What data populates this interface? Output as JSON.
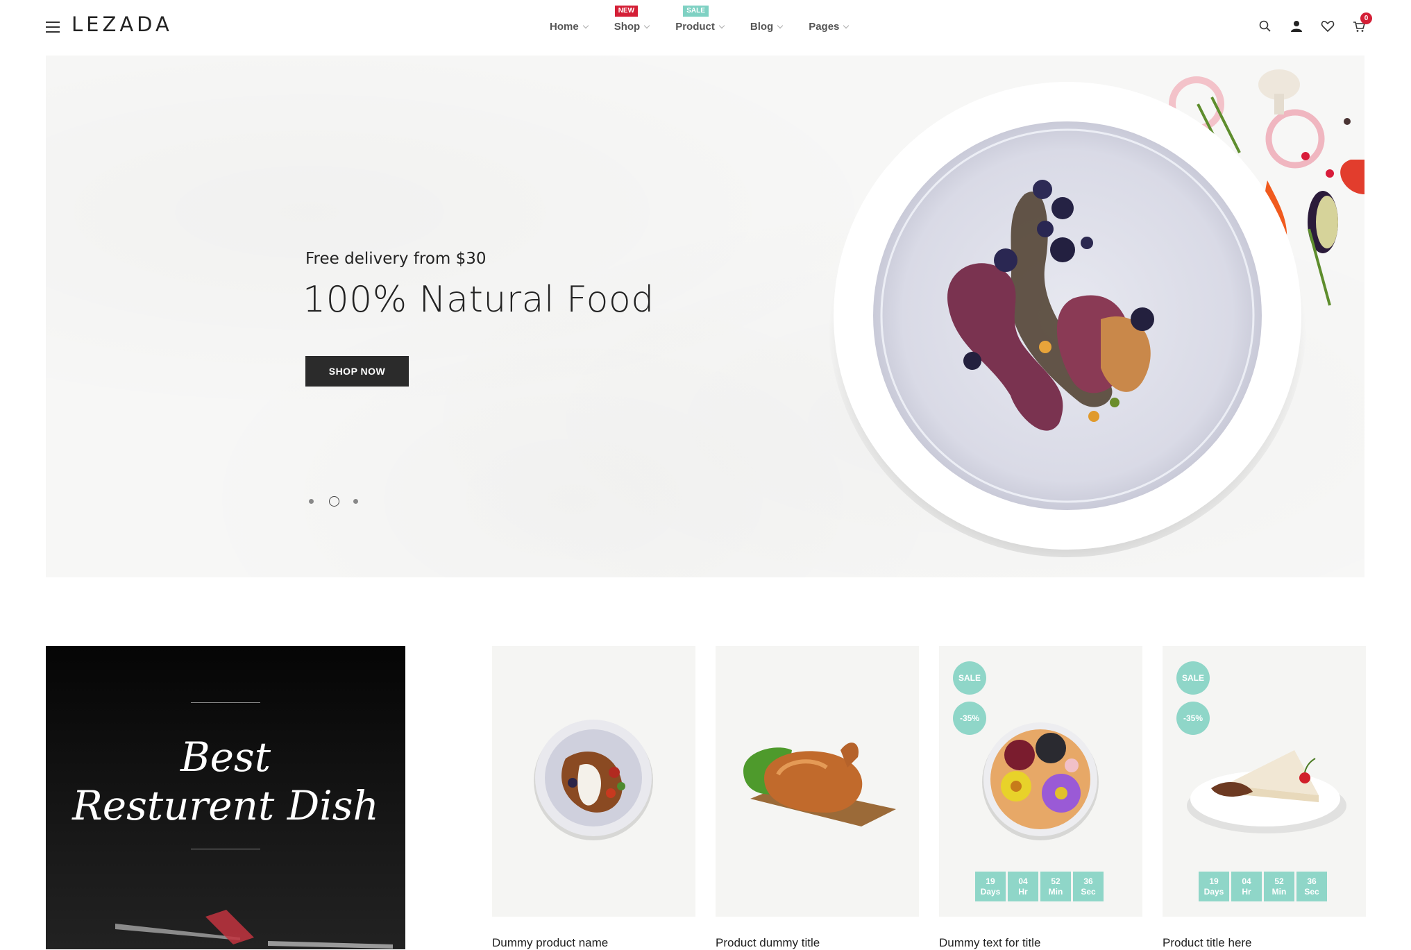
{
  "header": {
    "logo": "LEZADA",
    "nav": [
      {
        "label": "Home",
        "badge": ""
      },
      {
        "label": "Shop",
        "badge": "NEW"
      },
      {
        "label": "Product",
        "badge": "SALE"
      },
      {
        "label": "Blog",
        "badge": ""
      },
      {
        "label": "Pages",
        "badge": ""
      }
    ],
    "icons": [
      "search-icon",
      "user-icon",
      "heart-icon",
      "cart-icon"
    ],
    "cart_count": "0"
  },
  "hero": {
    "subtitle": "Free delivery from $30",
    "title": "100% Natural Food",
    "button": "SHOP NOW",
    "slides": 3,
    "active_slide": 2
  },
  "promo": {
    "line1": "Best",
    "line2": "Resturent Dish"
  },
  "products": [
    {
      "title": "Dummy product name",
      "sale": "",
      "discount": "",
      "countdown": null
    },
    {
      "title": "Product dummy title",
      "sale": "",
      "discount": "",
      "countdown": null
    },
    {
      "title": "Dummy text for title",
      "sale": "SALE",
      "discount": "-35%",
      "countdown": [
        [
          "19",
          "Days"
        ],
        [
          "04",
          "Hr"
        ],
        [
          "52",
          "Min"
        ],
        [
          "36",
          "Sec"
        ]
      ]
    },
    {
      "title": "Product title here",
      "sale": "SALE",
      "discount": "-35%",
      "countdown": [
        [
          "19",
          "Days"
        ],
        [
          "04",
          "Hr"
        ],
        [
          "52",
          "Min"
        ],
        [
          "36",
          "Sec"
        ]
      ]
    }
  ],
  "colors": {
    "accent": "#8fd6c8",
    "new_badge": "#d41f36",
    "button": "#2b2b2b"
  }
}
